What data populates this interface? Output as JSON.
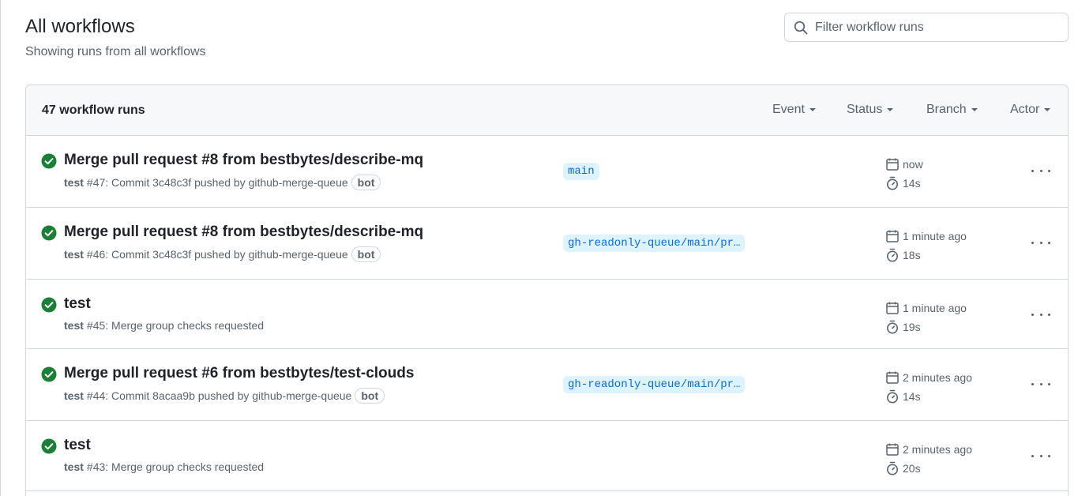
{
  "header": {
    "title": "All workflows",
    "subtitle": "Showing runs from all workflows"
  },
  "search": {
    "placeholder": "Filter workflow runs",
    "icon": "search-icon"
  },
  "runs_box": {
    "count_label": "47 workflow runs",
    "filters": [
      "Event",
      "Status",
      "Branch",
      "Actor"
    ]
  },
  "colors": {
    "success": "#1a7f37",
    "branch_bg": "#ddf4ff",
    "branch_text": "#0969da"
  },
  "runs": [
    {
      "title": "Merge pull request #8 from bestbytes/describe-mq",
      "workflow": "test",
      "number": "#47",
      "description": ": Commit 3c48c3f pushed by github-merge-queue",
      "badge": "bot",
      "branch": "main",
      "time": "now",
      "duration": "14s"
    },
    {
      "title": "Merge pull request #8 from bestbytes/describe-mq",
      "workflow": "test",
      "number": "#46",
      "description": ": Commit 3c48c3f pushed by github-merge-queue",
      "badge": "bot",
      "branch": "gh-readonly-queue/main/pr…",
      "time": "1 minute ago",
      "duration": "18s"
    },
    {
      "title": "test",
      "workflow": "test",
      "number": "#45",
      "description": ": Merge group checks requested",
      "badge": "",
      "branch": "",
      "time": "1 minute ago",
      "duration": "19s"
    },
    {
      "title": "Merge pull request #6 from bestbytes/test-clouds",
      "workflow": "test",
      "number": "#44",
      "description": ": Commit 8acaa9b pushed by github-merge-queue",
      "badge": "bot",
      "branch": "gh-readonly-queue/main/pr…",
      "time": "2 minutes ago",
      "duration": "14s"
    },
    {
      "title": "test",
      "workflow": "test",
      "number": "#43",
      "description": ": Merge group checks requested",
      "badge": "",
      "branch": "",
      "time": "2 minutes ago",
      "duration": "20s"
    }
  ]
}
